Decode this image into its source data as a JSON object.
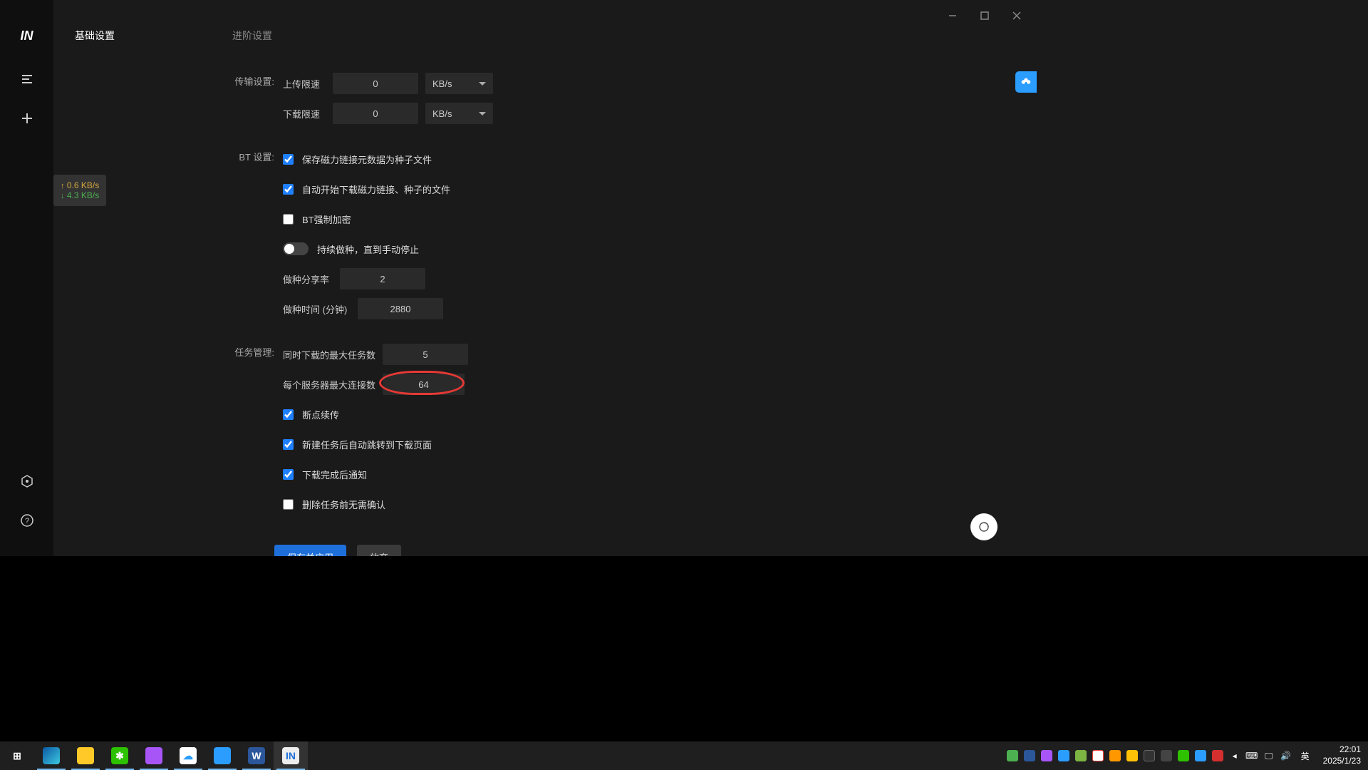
{
  "tabs": {
    "basic": "基础设置",
    "advanced": "进阶设置"
  },
  "transfer": {
    "section_label": "传输设置:",
    "upload_label": "上传限速",
    "upload_value": "0",
    "download_label": "下载限速",
    "download_value": "0",
    "unit": "KB/s"
  },
  "bt": {
    "section_label": "BT 设置:",
    "save_metadata": "保存磁力链接元数据为种子文件",
    "auto_start": "自动开始下载磁力链接、种子的文件",
    "force_encrypt": "BT强制加密",
    "keep_seeding": "持续做种，直到手动停止",
    "share_ratio_label": "做种分享率",
    "share_ratio_value": "2",
    "seed_time_label": "做种时间 (分钟)",
    "seed_time_value": "2880"
  },
  "task": {
    "section_label": "任务管理:",
    "max_concurrent_label": "同时下载的最大任务数",
    "max_concurrent_value": "5",
    "max_conn_label": "每个服务器最大连接数",
    "max_conn_value": "64",
    "resume": "断点续传",
    "jump_after_new": "新建任务后自动跳转到下载页面",
    "notify_done": "下载完成后通知",
    "no_confirm_delete": "删除任务前无需确认"
  },
  "buttons": {
    "save": "保存并应用",
    "discard": "放弃"
  },
  "speed_badge": {
    "up": "0.6 KB/s",
    "down": "4.3 KB/s"
  },
  "clock": {
    "time": "22:01",
    "date": "2025/1/23",
    "ime": "英"
  }
}
